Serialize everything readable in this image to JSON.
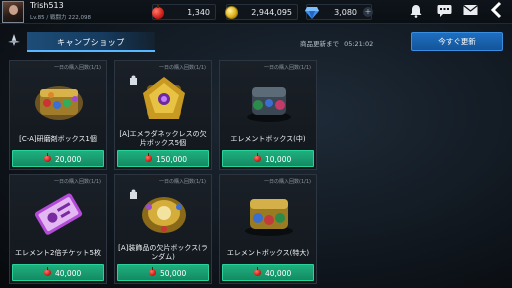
{
  "player": {
    "name": "Trish513",
    "level_line": "Lv.85 / 戦闘力 222,098"
  },
  "currencies": {
    "apple": "1,340",
    "gold": "2,944,095",
    "gem": "3,080"
  },
  "icons": {
    "bell": "bell-icon",
    "chat": "chat-icon",
    "mail": "mail-icon",
    "back": "back-arrow-icon"
  },
  "tabs": [
    {
      "label": "キャンプショップ",
      "active": true
    }
  ],
  "shop": {
    "refresh_label": "商品更新まで",
    "refresh_time": "05:21:02",
    "refresh_button": "今すぐ更新"
  },
  "items": [
    {
      "limit": "一日の購入回数(1/1)",
      "name": "[C-A]研磨剤ボックス1個",
      "price": "20,000"
    },
    {
      "limit": "一日の購入回数(1/1)",
      "name": "[A]エメラダネックレスの欠片ボックス5個",
      "price": "150,000"
    },
    {
      "limit": "一日の購入回数(1/1)",
      "name": "エレメントボックス(中)",
      "price": "10,000"
    },
    {
      "limit": "一日の購入回数(1/1)",
      "name": "エレメント2倍チケット5枚",
      "price": "40,000"
    },
    {
      "limit": "一日の購入回数(1/1)",
      "name": "[A]装飾品の欠片ボックス(ランダム)",
      "price": "50,000"
    },
    {
      "limit": "一日の購入回数(1/1)",
      "name": "エレメントボックス(特大)",
      "price": "40,000"
    }
  ],
  "colors": {
    "price_button": "#1fb080",
    "refresh_button": "#1e6fc0",
    "tab_active": "#1d4d78"
  }
}
